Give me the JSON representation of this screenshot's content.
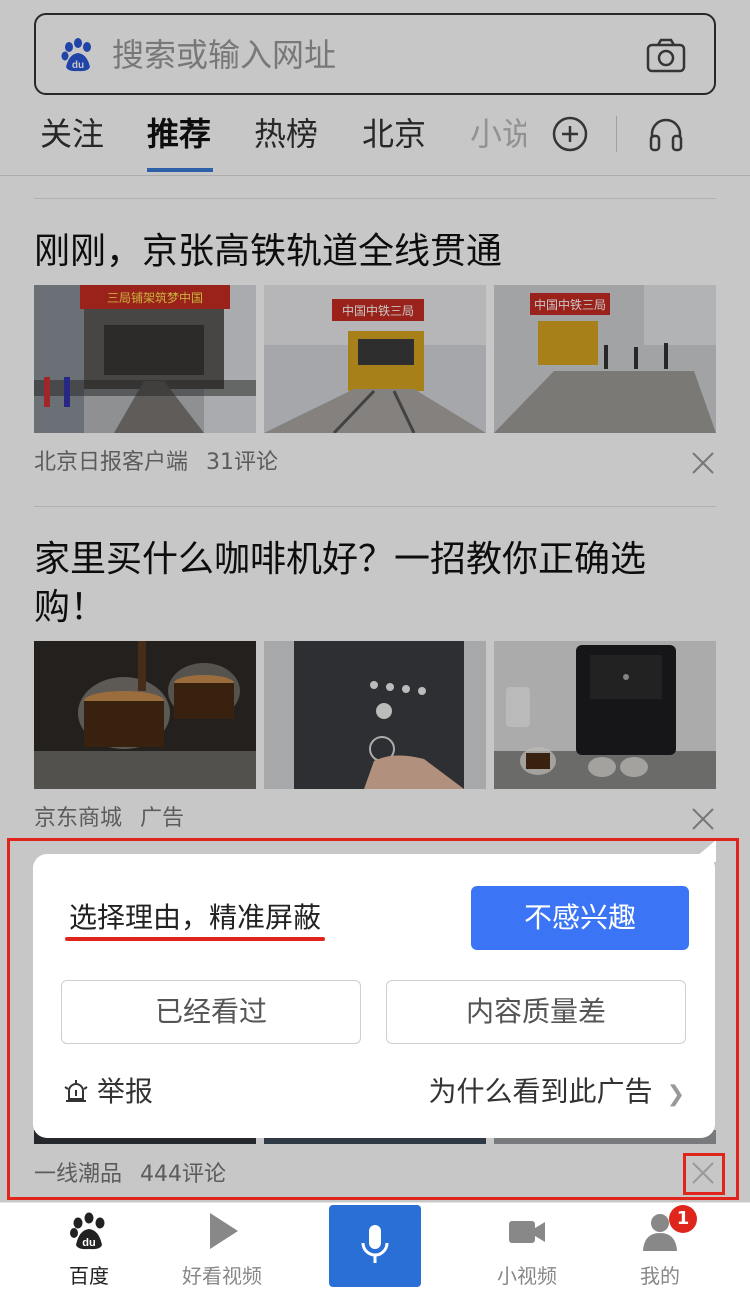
{
  "search": {
    "placeholder": "搜索或输入网址"
  },
  "tabs": [
    {
      "label": "关注"
    },
    {
      "label": "推荐"
    },
    {
      "label": "热榜"
    },
    {
      "label": "北京"
    },
    {
      "label": "小说"
    }
  ],
  "articles": [
    {
      "title": "刚刚，京张高铁轨道全线贯通",
      "source": "北京日报客户端",
      "comments": "31评论",
      "thumbs": [
        {
          "banner": "三局铺架筑梦中国"
        },
        {
          "banner": "中国中铁三局"
        },
        {
          "banner": "中国中铁三局"
        }
      ]
    },
    {
      "title": "家里买什么咖啡机好？一招教你正确选购！",
      "source": "京东商城",
      "tag": "广告"
    },
    {
      "source": "一线潮品",
      "comments": "444评论"
    }
  ],
  "popup": {
    "reason_title": "选择理由，精准屏蔽",
    "primary_button": "不感兴趣",
    "option_1": "已经看过",
    "option_2": "内容质量差",
    "report": "举报",
    "why_ad": "为什么看到此广告"
  },
  "bottom_nav": {
    "baidu": "百度",
    "haokan": "好看视频",
    "small_video": "小视频",
    "mine": "我的",
    "badge_count": "1"
  },
  "colors": {
    "accent": "#3b75f5",
    "annotation_red": "#e0261c",
    "mic_blue": "#2a6fd6"
  }
}
